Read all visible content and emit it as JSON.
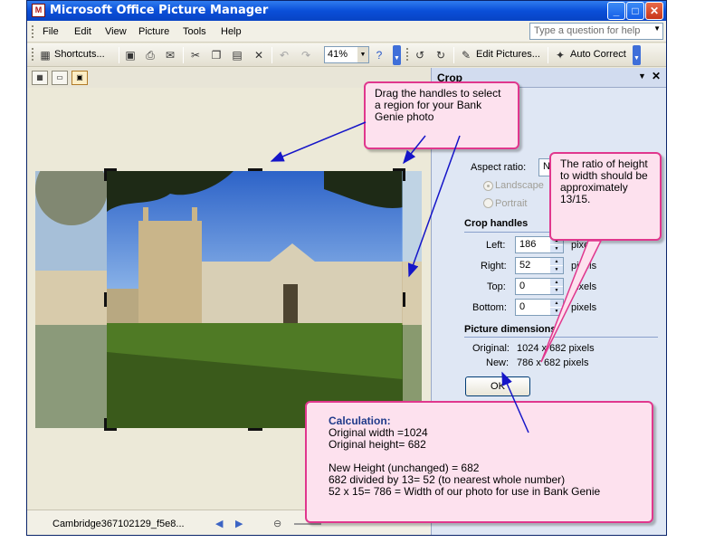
{
  "window": {
    "title": "Microsoft Office Picture Manager",
    "icon_name": "picture-manager-icon"
  },
  "menu": {
    "items": [
      "File",
      "Edit",
      "View",
      "Picture",
      "Tools",
      "Help"
    ],
    "ask_placeholder": "Type a question for help"
  },
  "toolbar": {
    "shortcuts_label": "Shortcuts...",
    "zoom_value": "41%",
    "edit_pictures_label": "Edit Pictures...",
    "auto_correct_label": "Auto Correct"
  },
  "status": {
    "filename": "Cambridge367102129_f5e8..."
  },
  "task_pane": {
    "title": "Crop",
    "aspect_ratio_label": "Aspect ratio:",
    "aspect_ratio_value": "None",
    "landscape_label": "Landscape",
    "portrait_label": "Portrait",
    "crop_handles_heading": "Crop handles",
    "left_label": "Left:",
    "left_value": "186",
    "right_label": "Right:",
    "right_value": "52",
    "top_label": "Top:",
    "top_value": "0",
    "bottom_label": "Bottom:",
    "bottom_value": "0",
    "units": "pixels",
    "picture_dimensions_heading": "Picture dimensions",
    "original_label": "Original:",
    "original_value": "1024 x 682 pixels",
    "new_label": "New:",
    "new_value": "786 x 682 pixels",
    "ok_label": "OK"
  },
  "callouts": {
    "drag_text": "Drag the handles to select a region for your Bank Genie photo",
    "ratio_text": "The ratio of height to width should be approximately 13/15.",
    "calc_title": "Calculation:",
    "calc_lines": [
      "Original width =1024",
      "Original height= 682",
      "",
      "New Height (unchanged) = 682",
      "682 divided by 13= 52 (to nearest whole number)",
      "52 x 15= 786 = Width of our photo for use in Bank Genie"
    ]
  },
  "colors": {
    "callout_border": "#e0378d",
    "callout_fill": "#fde1ee",
    "arrow": "#1515c8",
    "calc_title": "#1f3a8a"
  }
}
